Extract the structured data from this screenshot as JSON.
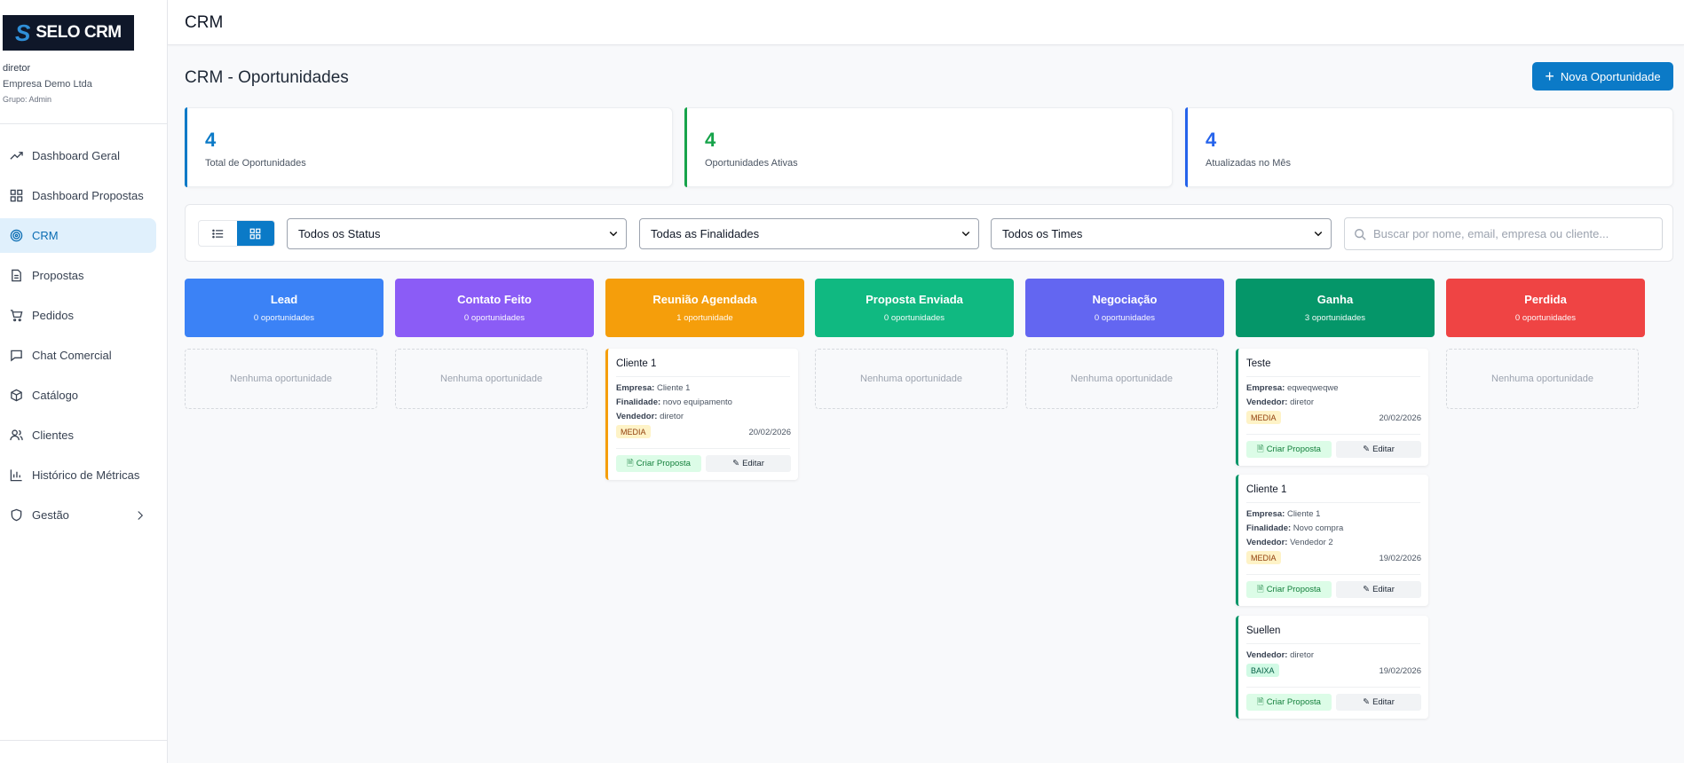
{
  "brand": {
    "mark": "S",
    "name": "SELO CRM"
  },
  "user": {
    "name": "diretor",
    "company": "Empresa Demo Ltda",
    "group": "Grupo: Admin"
  },
  "nav": [
    {
      "label": "Dashboard Geral",
      "icon": "trending-up-icon"
    },
    {
      "label": "Dashboard Propostas",
      "icon": "grid-icon"
    },
    {
      "label": "CRM",
      "icon": "target-icon",
      "active": true
    },
    {
      "label": "Propostas",
      "icon": "file-text-icon"
    },
    {
      "label": "Pedidos",
      "icon": "cart-icon"
    },
    {
      "label": "Chat Comercial",
      "icon": "chat-icon"
    },
    {
      "label": "Catálogo",
      "icon": "box-icon"
    },
    {
      "label": "Clientes",
      "icon": "users-icon"
    },
    {
      "label": "Histórico de Métricas",
      "icon": "bar-chart-icon"
    },
    {
      "label": "Gestão",
      "icon": "shield-icon",
      "chevron": true
    }
  ],
  "header": {
    "title": "CRM"
  },
  "page": {
    "title": "CRM - Oportunidades",
    "new_button": "Nova Oportunidade"
  },
  "stats": [
    {
      "value": "4",
      "label": "Total de Oportunidades",
      "color": "#0b7ac7"
    },
    {
      "value": "4",
      "label": "Oportunidades Ativas",
      "color": "#16a34a"
    },
    {
      "value": "4",
      "label": "Atualizadas no Mês",
      "color": "#2563eb"
    }
  ],
  "filters": {
    "status": "Todos os Status",
    "finalidade": "Todas as Finalidades",
    "times": "Todos os Times",
    "search_placeholder": "Buscar por nome, email, empresa ou cliente..."
  },
  "columns": [
    {
      "title": "Lead",
      "count": "0 oportunidades",
      "color": "#3b82f6"
    },
    {
      "title": "Contato Feito",
      "count": "0 oportunidades",
      "color": "#8b5cf6"
    },
    {
      "title": "Reunião Agendada",
      "count": "1 oportunidade",
      "color": "#f59e0b"
    },
    {
      "title": "Proposta Enviada",
      "count": "0 oportunidades",
      "color": "#10b981"
    },
    {
      "title": "Negociação",
      "count": "0 oportunidades",
      "color": "#6366f1"
    },
    {
      "title": "Ganha",
      "count": "3 oportunidades",
      "color": "#059669"
    },
    {
      "title": "Perdida",
      "count": "0 oportunidades",
      "color": "#ef4444"
    }
  ],
  "empty_text": "Nenhuma oportunidade",
  "labels": {
    "empresa": "Empresa:",
    "finalidade": "Finalidade:",
    "vendedor": "Vendedor:",
    "create": "Criar Proposta",
    "edit": "Editar"
  },
  "cards": {
    "reuniao": [
      {
        "title": "Cliente 1",
        "empresa": "Cliente 1",
        "finalidade": "novo equipamento",
        "vendedor": "diretor",
        "priority": "MEDIA",
        "date": "20/02/2026"
      }
    ],
    "ganha": [
      {
        "title": "Teste",
        "empresa": "eqweqweqwe",
        "vendedor": "diretor",
        "priority": "MEDIA",
        "date": "20/02/2026"
      },
      {
        "title": "Cliente 1",
        "empresa": "Cliente 1",
        "finalidade": "Novo compra",
        "vendedor": "Vendedor 2",
        "priority": "MEDIA",
        "date": "19/02/2026"
      },
      {
        "title": "Suellen",
        "vendedor": "diretor",
        "priority": "BAIXA",
        "date": "19/02/2026"
      }
    ]
  }
}
